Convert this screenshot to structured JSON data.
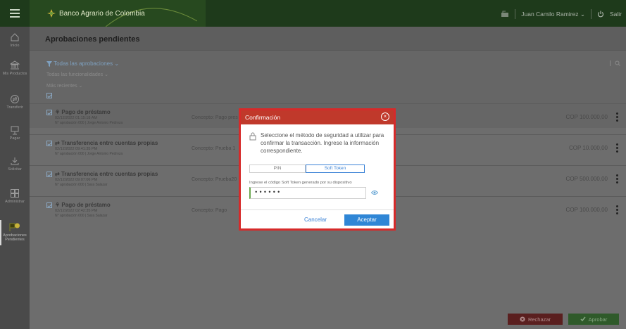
{
  "topbar": {
    "brand": "Banco Agrario de Colombia",
    "user": "Juan Camilo Ramirez ⌄",
    "logout": "Salir"
  },
  "sidebar": [
    {
      "label": "Inicio",
      "icon": "home-icon"
    },
    {
      "label": "Mis Productos",
      "icon": "bank-icon"
    },
    {
      "label": "Transferir",
      "icon": "transfer-icon"
    },
    {
      "label": "Pagar",
      "icon": "pay-icon"
    },
    {
      "label": "Solicitar",
      "icon": "request-icon"
    },
    {
      "label": "Administrar",
      "icon": "admin-icon"
    },
    {
      "label": "Aprobaciones Pendientes",
      "icon": "approvals-icon"
    }
  ],
  "page": {
    "title": "Aprobaciones pendientes"
  },
  "filters": {
    "type": "Todas las aprobaciones ⌄",
    "functionality": "Todas las funcionalidades ⌄",
    "order": "Más recientes ⌄"
  },
  "rows": [
    {
      "title": "Pago de préstamo",
      "date": "02/12/2022 01:15:18 AM",
      "approver": "N° aprobación 000 | Jorge Antonio Pedroza",
      "concept": "Concepto: Pago pres",
      "amount": "COP 100.000,00"
    },
    {
      "title": "Transferencia entre cuentas propias",
      "date": "02/12/2022 09:41:35 PM",
      "approver": "N° aprobación 000 | Jorge Antonio Pedroza",
      "concept": "Concepto: Prueba 1",
      "amount": "COP 10.000,00"
    },
    {
      "title": "Transferencia entre cuentas propias",
      "date": "02/12/2022 09:07:06 PM",
      "approver": "N° aprobación 000 | Sara Salazar",
      "concept": "Concepto: Prueba20",
      "amount": "COP 500.000,00"
    },
    {
      "title": "Pago de préstamo",
      "date": "02/12/2022 02:42:35 PM",
      "approver": "N° aprobación 000 | Sara Salazar",
      "concept": "Concepto: Pago",
      "amount": "COP 100.000,00"
    }
  ],
  "actions": {
    "reject": "Rechazar",
    "approve": "Aprobar"
  },
  "modal": {
    "title": "Confirmación",
    "message": "Seleccione el método de seguridad a utilizar para confirmar la transacción. Ingrese la información correspondiente.",
    "options": [
      "PIN",
      "Soft Token"
    ],
    "selected": "Soft Token",
    "token_label": "Ingrese el código Soft Token generado por su dispositivo",
    "token_value": "••••••",
    "cancel": "Cancelar",
    "accept": "Aceptar"
  },
  "colors": {
    "modal_header": "#c0392b",
    "highlight_outline": "#d62a2a",
    "accent": "#2f86d6",
    "reject": "#5a1f1f",
    "approve": "#2f5a2a"
  }
}
